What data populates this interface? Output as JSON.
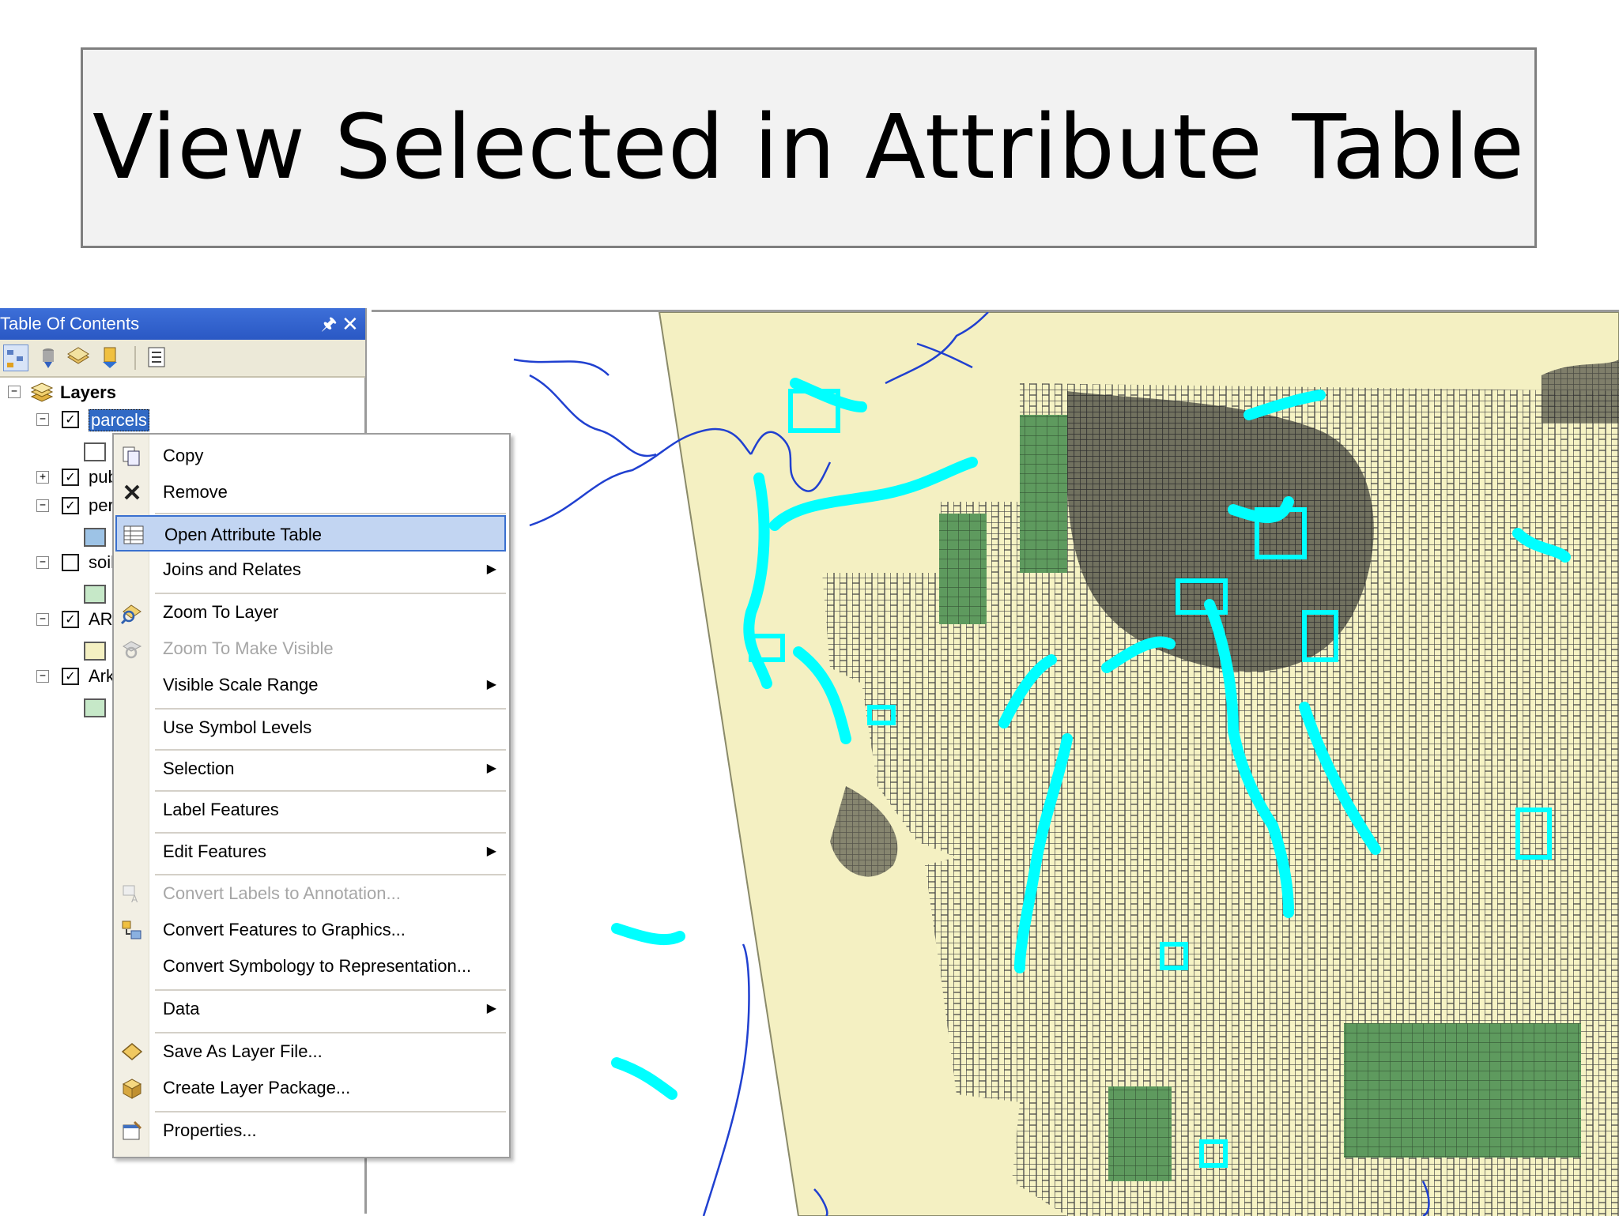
{
  "slide": {
    "title": "View Selected in Attribute Table"
  },
  "toc": {
    "title": "Table Of Contents",
    "pin_icon": "pin-icon",
    "close_icon": "close-icon",
    "root_label": "Layers",
    "layers": [
      {
        "label": "parcels",
        "checked": true,
        "expanded": true,
        "selected": true,
        "swatch": "#ffffff"
      },
      {
        "label": "pub",
        "checked": true,
        "expanded": false
      },
      {
        "label": "per",
        "checked": true,
        "expanded": true,
        "swatch": "#9dc3e6"
      },
      {
        "label": "soil",
        "checked": false,
        "expanded": true,
        "swatch": "#c6e8c8"
      },
      {
        "label": "AR.",
        "checked": true,
        "expanded": true,
        "swatch": "#f4f0c2"
      },
      {
        "label": "Ark",
        "checked": true,
        "expanded": true,
        "swatch": "#c6e8c8"
      }
    ]
  },
  "context_menu": {
    "items": [
      {
        "label": "Copy",
        "icon": "copy-icon"
      },
      {
        "label": "Remove",
        "icon": "remove-icon"
      },
      {
        "label": "Open Attribute Table",
        "icon": "table-icon",
        "highlighted": true
      },
      {
        "label": "Joins and Relates",
        "submenu": true
      },
      {
        "label": "Zoom To Layer",
        "icon": "zoom-layer-icon"
      },
      {
        "label": "Zoom To Make Visible",
        "icon": "zoom-visible-icon",
        "disabled": true
      },
      {
        "label": "Visible Scale Range",
        "submenu": true
      },
      {
        "label": "Use Symbol Levels"
      },
      {
        "label": "Selection",
        "submenu": true
      },
      {
        "label": "Label Features"
      },
      {
        "label": "Edit Features",
        "submenu": true
      },
      {
        "label": "Convert Labels to Annotation...",
        "icon": "convert-labels-icon",
        "disabled": true
      },
      {
        "label": "Convert Features to Graphics...",
        "icon": "convert-graphics-icon"
      },
      {
        "label": "Convert Symbology to Representation..."
      },
      {
        "label": "Data",
        "submenu": true
      },
      {
        "label": "Save As Layer File...",
        "icon": "layer-file-icon"
      },
      {
        "label": "Create Layer Package...",
        "icon": "layer-package-icon"
      },
      {
        "label": "Properties...",
        "icon": "properties-icon"
      }
    ]
  },
  "map": {
    "colors": {
      "land": "#f6f3c4",
      "parcel_lines": "#3e3e3e",
      "green_layer": "#5e9a5e",
      "selection": "#00ffff",
      "rivers": "#2040d0"
    }
  }
}
